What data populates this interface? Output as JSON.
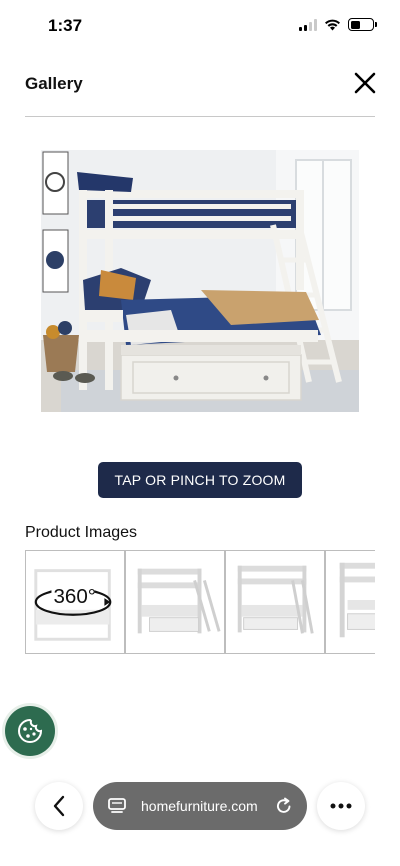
{
  "status_bar": {
    "time": "1:37",
    "icons": [
      "cellular-signal-icon",
      "wifi-icon",
      "battery-icon"
    ]
  },
  "header": {
    "title": "Gallery",
    "close_icon": "close-icon"
  },
  "main_image": {
    "subject": "bunk-bed-photo"
  },
  "zoom_button": {
    "label": "TAP OR PINCH TO ZOOM",
    "color": "#1e2a4a"
  },
  "product_images": {
    "label": "Product Images",
    "thumbnails": [
      {
        "name": "thumbnail-360",
        "badge": "360°"
      },
      {
        "name": "thumbnail-front-view"
      },
      {
        "name": "thumbnail-front-straight"
      },
      {
        "name": "thumbnail-side-partial"
      }
    ]
  },
  "cookie_button": {
    "icon": "cookie-icon",
    "color": "#2d6b4f"
  },
  "browser_bar": {
    "url": "homefurniture.com",
    "icons": [
      "back-chevron-icon",
      "tabs-icon",
      "reload-icon",
      "more-dots-icon"
    ]
  }
}
